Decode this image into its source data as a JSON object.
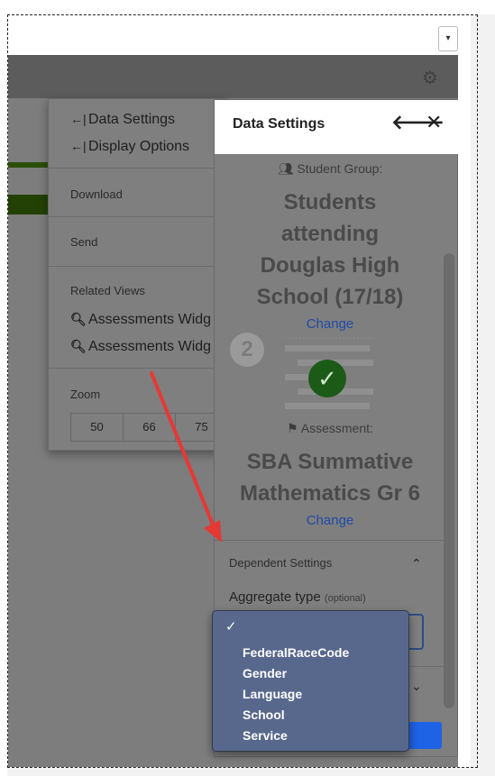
{
  "colors": {
    "accent": "#1e62e6",
    "link": "#1f4aa8",
    "annotation_arrow": "#e53935",
    "popup_bg": "#58688c"
  },
  "top": {
    "dropdown_icon": "▾"
  },
  "toolbar": {
    "settings_icon": "gear-icon"
  },
  "menu": {
    "items": [
      {
        "label": "Data Settings",
        "icon": "←|"
      },
      {
        "label": "Display Options",
        "icon": "←|"
      }
    ],
    "download": "Download",
    "send": "Send",
    "related_views_label": "Related Views",
    "related_views": [
      {
        "label": "Assessments Widg"
      },
      {
        "label": "Assessments Widg"
      }
    ],
    "zoom_label": "Zoom",
    "zoom_options": [
      "50",
      "66",
      "75"
    ]
  },
  "panel": {
    "title": "Data Settings",
    "back_icon": "🡐",
    "close_icon": "✕",
    "student_group_label": "Student Group:",
    "student_group_lines": [
      "Students",
      "attending",
      "Douglas High",
      "School (17/18)"
    ],
    "change_link_1": "Change",
    "step_number": "2",
    "check_glyph": "✓",
    "assessment_label": "Assessment:",
    "assessment_lines": [
      "SBA Summative",
      "Mathematics Gr 6"
    ],
    "change_link_2": "Change",
    "dependent_settings_label": "Dependent Settings",
    "aggregate_type_label": "Aggregate type",
    "aggregate_type_optional": "(optional)"
  },
  "dropdown": {
    "selected_check": "✓",
    "options": [
      "FederalRaceCode",
      "Gender",
      "Language",
      "School",
      "Service"
    ]
  }
}
